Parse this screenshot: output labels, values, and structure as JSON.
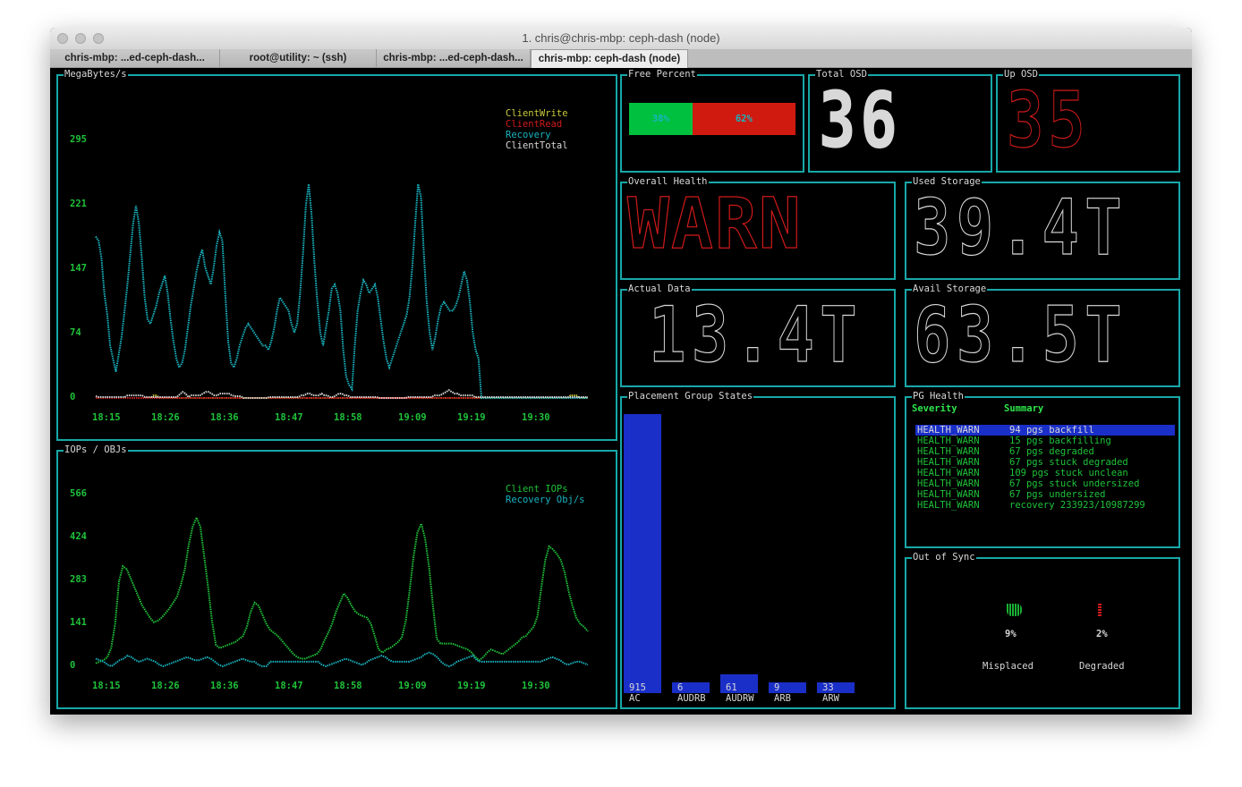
{
  "window": {
    "title": "1. chris@chris-mbp: ceph-dash (node)",
    "tabs": [
      {
        "label": "chris-mbp: ...ed-ceph-dash...",
        "active": false
      },
      {
        "label": "root@utility: ~ (ssh)",
        "active": false
      },
      {
        "label": "chris-mbp: ...ed-ceph-dash...",
        "active": false
      },
      {
        "label": "chris-mbp: ceph-dash (node)",
        "active": true
      }
    ]
  },
  "colors": {
    "border": "#18a8a8",
    "axis_green": "#1fc23a",
    "client_write": "#c8c83a",
    "client_read": "#d01a1a",
    "recovery": "#18b4c0",
    "client_total": "#d8d8d8",
    "client_iops": "#1fc23a",
    "bar_blue": "#1a2fc8",
    "free_green": "#00c040",
    "free_red": "#d01a10"
  },
  "mbps_panel": {
    "label": "MegaBytes/s",
    "legend": [
      "ClientWrite",
      "ClientRead",
      "Recovery",
      "ClientTotal"
    ]
  },
  "iops_panel": {
    "label": "IOPs / OBJs",
    "legend": [
      "Client IOPs",
      "Recovery Obj/s"
    ]
  },
  "chart_data": [
    {
      "type": "line",
      "title": "MegaBytes/s",
      "x": [
        "18:15",
        "18:26",
        "18:36",
        "18:47",
        "18:58",
        "19:09",
        "19:19",
        "19:30"
      ],
      "yticks": [
        "295",
        "221",
        "147",
        "74",
        "0"
      ],
      "ylim": [
        0,
        295
      ],
      "legend_position": "top-right",
      "series": [
        {
          "name": "ClientWrite",
          "values": [
            0,
            0,
            0,
            0,
            0,
            0,
            0,
            0,
            0,
            0,
            0,
            0,
            0,
            0,
            0,
            0,
            0,
            0,
            0,
            0,
            3,
            3,
            0,
            0,
            0,
            0,
            0,
            0,
            0,
            0,
            0,
            0,
            0,
            0,
            0,
            0,
            0,
            0,
            0,
            0,
            0,
            0,
            0,
            0,
            0,
            0,
            0,
            0,
            0,
            0,
            0,
            0,
            0,
            0,
            0,
            0,
            0,
            0,
            0,
            0,
            0,
            0,
            0,
            0,
            0,
            0,
            0,
            0,
            0,
            0,
            0,
            0,
            0,
            0,
            0,
            0,
            0,
            0,
            0,
            0,
            0,
            0,
            0,
            0,
            0,
            0,
            0,
            0,
            0,
            0,
            0,
            0,
            0,
            0,
            0,
            0,
            0,
            0,
            0,
            0,
            0,
            0,
            0,
            0,
            0,
            0,
            0,
            0,
            0,
            0,
            0,
            0,
            0,
            0,
            0,
            0,
            0,
            0,
            0,
            0,
            0,
            0,
            0,
            0,
            0,
            0,
            0,
            0,
            0,
            0,
            0,
            0,
            0,
            0,
            0,
            0,
            0,
            0,
            0,
            0,
            0,
            0,
            0,
            0,
            0,
            0,
            0,
            0,
            0,
            0,
            0,
            0,
            0,
            0,
            0,
            0,
            0,
            0,
            0,
            0,
            0,
            0,
            0,
            0,
            3,
            3,
            3,
            0,
            0,
            0,
            0
          ]
        },
        {
          "name": "ClientRead",
          "values": [
            0,
            0,
            0,
            0,
            0,
            0,
            0,
            0,
            0,
            0,
            0,
            0,
            0,
            0,
            0,
            0,
            0,
            0,
            0,
            0,
            0,
            0,
            0,
            0,
            0,
            0,
            0,
            0,
            0,
            0,
            0,
            0,
            0,
            0,
            0,
            0,
            0,
            0,
            0,
            0,
            0,
            0,
            0,
            0,
            0,
            0,
            0,
            0,
            0,
            0,
            0,
            0,
            0,
            0,
            0,
            0,
            0,
            0,
            0,
            0,
            0,
            0,
            0,
            0,
            0,
            0,
            0,
            0,
            0,
            0,
            0,
            0,
            0,
            0,
            0,
            0,
            0,
            0,
            0,
            0,
            0,
            0,
            0,
            0,
            0,
            0,
            0,
            0,
            0,
            0,
            0,
            0,
            0,
            0,
            0,
            0,
            0,
            0,
            0,
            0,
            0,
            0,
            0,
            0,
            0,
            0,
            0,
            0,
            0,
            0,
            0,
            0,
            0,
            0,
            0,
            0,
            0,
            0,
            0,
            0,
            0,
            0,
            0,
            0,
            0,
            0,
            0,
            0,
            0,
            0,
            0,
            0,
            0,
            0,
            0,
            0,
            0,
            0,
            0,
            0,
            0,
            0,
            0,
            0,
            0,
            0,
            0,
            0,
            0,
            0,
            0,
            0,
            0,
            0,
            0,
            0,
            0,
            0,
            0,
            0,
            0,
            0,
            0,
            0,
            0,
            0,
            0,
            0,
            0,
            0,
            0
          ]
        },
        {
          "name": "Recovery",
          "values": [
            185,
            180,
            160,
            120,
            95,
            60,
            45,
            30,
            50,
            70,
            100,
            130,
            165,
            200,
            220,
            200,
            160,
            115,
            90,
            85,
            95,
            105,
            120,
            130,
            140,
            120,
            90,
            65,
            45,
            35,
            40,
            55,
            80,
            105,
            125,
            145,
            160,
            170,
            150,
            140,
            130,
            150,
            175,
            190,
            180,
            120,
            65,
            40,
            35,
            45,
            60,
            70,
            80,
            85,
            80,
            75,
            70,
            65,
            60,
            60,
            55,
            65,
            80,
            100,
            115,
            110,
            105,
            100,
            85,
            75,
            85,
            120,
            165,
            220,
            245,
            210,
            155,
            110,
            75,
            60,
            80,
            100,
            125,
            130,
            120,
            100,
            55,
            25,
            15,
            10,
            60,
            100,
            120,
            135,
            130,
            120,
            125,
            130,
            115,
            90,
            65,
            45,
            35,
            45,
            55,
            65,
            75,
            85,
            95,
            115,
            150,
            200,
            245,
            230,
            165,
            110,
            75,
            55,
            70,
            90,
            105,
            110,
            105,
            100,
            100,
            105,
            115,
            130,
            145,
            135,
            110,
            75,
            55,
            45,
            0,
            0,
            0,
            0,
            0,
            0,
            0,
            0,
            0,
            0,
            0,
            0,
            0,
            0,
            0,
            0,
            0,
            0,
            0,
            0,
            0,
            0,
            0,
            0,
            0,
            0,
            0,
            0,
            0,
            0,
            0,
            0,
            0,
            0,
            0,
            0,
            0,
            0
          ]
        },
        {
          "name": "ClientTotal",
          "values": [
            2,
            1,
            1,
            1,
            1,
            1,
            1,
            1,
            1,
            1,
            1,
            3,
            3,
            3,
            3,
            3,
            3,
            1,
            1,
            1,
            1,
            1,
            1,
            1,
            1,
            1,
            1,
            1,
            1,
            4,
            7,
            5,
            1,
            3,
            3,
            3,
            3,
            5,
            7,
            7,
            5,
            3,
            3,
            5,
            5,
            5,
            5,
            3,
            2,
            2,
            2,
            0,
            0,
            0,
            0,
            0,
            0,
            0,
            0,
            0,
            1,
            1,
            1,
            1,
            1,
            1,
            1,
            1,
            1,
            1,
            1,
            3,
            3,
            5,
            5,
            3,
            3,
            3,
            5,
            3,
            3,
            1,
            1,
            3,
            5,
            5,
            3,
            3,
            1,
            1,
            1,
            1,
            1,
            1,
            1,
            1,
            1,
            1,
            0,
            0,
            0,
            0,
            0,
            0,
            0,
            0,
            0,
            0,
            1,
            1,
            1,
            1,
            1,
            1,
            1,
            1,
            1,
            3,
            3,
            3,
            5,
            7,
            9,
            7,
            5,
            5,
            3,
            3,
            3,
            3,
            3,
            1,
            1,
            1,
            1,
            1,
            1,
            1,
            1,
            1,
            1,
            1,
            1,
            1,
            1,
            1,
            1,
            1,
            1,
            1,
            1,
            1,
            1,
            1,
            1,
            1,
            1,
            1,
            1,
            1,
            1,
            1,
            1,
            1,
            1,
            1,
            1,
            1,
            1,
            1,
            1
          ]
        }
      ]
    },
    {
      "type": "line",
      "title": "IOPs / OBJs",
      "x": [
        "18:15",
        "18:26",
        "18:36",
        "18:47",
        "18:58",
        "19:09",
        "19:19",
        "19:30"
      ],
      "yticks": [
        "566",
        "424",
        "283",
        "141",
        "0"
      ],
      "ylim": [
        0,
        566
      ],
      "legend_position": "top-right",
      "series": [
        {
          "name": "Client IOPs",
          "values": [
            10,
            15,
            20,
            30,
            60,
            140,
            280,
            330,
            320,
            290,
            260,
            230,
            200,
            180,
            160,
            145,
            150,
            160,
            175,
            190,
            210,
            230,
            270,
            320,
            400,
            460,
            490,
            460,
            360,
            260,
            150,
            70,
            60,
            65,
            70,
            75,
            80,
            90,
            100,
            130,
            180,
            210,
            200,
            170,
            140,
            120,
            110,
            100,
            85,
            70,
            55,
            40,
            30,
            25,
            25,
            30,
            35,
            40,
            55,
            85,
            110,
            140,
            180,
            210,
            240,
            225,
            200,
            180,
            170,
            165,
            160,
            140,
            100,
            55,
            45,
            55,
            60,
            70,
            80,
            95,
            150,
            250,
            360,
            440,
            470,
            420,
            330,
            200,
            90,
            75,
            75,
            75,
            75,
            70,
            65,
            60,
            55,
            45,
            30,
            20,
            30,
            45,
            55,
            50,
            45,
            40,
            50,
            60,
            70,
            80,
            95,
            100,
            115,
            130,
            165,
            260,
            350,
            395,
            385,
            370,
            350,
            310,
            250,
            200,
            160,
            140,
            130,
            115
          ]
        },
        {
          "name": "Recovery Obj/s",
          "values": [
            25,
            20,
            15,
            5,
            0,
            10,
            20,
            25,
            35,
            30,
            20,
            15,
            20,
            25,
            20,
            15,
            5,
            0,
            5,
            10,
            15,
            20,
            25,
            30,
            25,
            20,
            20,
            25,
            30,
            25,
            15,
            5,
            0,
            5,
            10,
            15,
            20,
            25,
            20,
            15,
            15,
            5,
            0,
            0,
            15,
            15,
            15,
            15,
            15,
            15,
            15,
            15,
            15,
            15,
            15,
            15,
            15,
            5,
            0,
            5,
            10,
            15,
            20,
            25,
            20,
            15,
            10,
            5,
            10,
            20,
            25,
            30,
            35,
            30,
            20,
            15,
            15,
            15,
            15,
            15,
            20,
            25,
            30,
            40,
            45,
            40,
            30,
            15,
            5,
            0,
            5,
            15,
            20,
            25,
            30,
            35,
            20,
            15,
            15,
            15,
            15,
            15,
            15,
            15,
            15,
            15,
            15,
            15,
            15,
            15,
            15,
            15,
            15,
            20,
            25,
            30,
            25,
            20,
            10,
            5,
            10,
            15,
            15,
            10,
            5
          ]
        }
      ]
    },
    {
      "type": "bar",
      "title": "Placement Group States",
      "categories": [
        "AC",
        "AUDRB",
        "AUDRW",
        "ARB",
        "ARW"
      ],
      "values": [
        915,
        6,
        61,
        9,
        33
      ],
      "ylim": [
        0,
        915
      ]
    }
  ],
  "free_percent": {
    "label": "Free Percent",
    "used_pct": 38,
    "free_pct": 62,
    "used_text": "38%",
    "free_text": "62%"
  },
  "total_osd": {
    "label": "Total OSD",
    "value": "36"
  },
  "up_osd": {
    "label": "Up OSD",
    "value": "35"
  },
  "overall_health": {
    "label": "Overall Health",
    "value": "WARN"
  },
  "used_storage": {
    "label": "Used Storage",
    "value": "39.4T"
  },
  "actual_data": {
    "label": "Actual Data",
    "value": "13.4T"
  },
  "avail_storage": {
    "label": "Avail Storage",
    "value": "63.5T"
  },
  "pg_states": {
    "label": "Placement Group States"
  },
  "pg_health": {
    "label": "PG Health",
    "headers": {
      "severity": "Severity",
      "summary": "Summary"
    },
    "rows": [
      {
        "severity": "HEALTH_WARN",
        "summary": "94 pgs backfill",
        "selected": true
      },
      {
        "severity": "HEALTH_WARN",
        "summary": "15 pgs backfilling"
      },
      {
        "severity": "HEALTH_WARN",
        "summary": "67 pgs degraded"
      },
      {
        "severity": "HEALTH_WARN",
        "summary": "67 pgs stuck degraded"
      },
      {
        "severity": "HEALTH_WARN",
        "summary": "109 pgs stuck unclean"
      },
      {
        "severity": "HEALTH_WARN",
        "summary": "67 pgs stuck undersized"
      },
      {
        "severity": "HEALTH_WARN",
        "summary": "67 pgs undersized"
      },
      {
        "severity": "HEALTH_WARN",
        "summary": "recovery 233923/10987299"
      }
    ]
  },
  "out_of_sync": {
    "label": "Out of Sync",
    "misplaced": {
      "pct": 9,
      "text": "9%",
      "label": "Misplaced"
    },
    "degraded": {
      "pct": 2,
      "text": "2%",
      "label": "Degraded"
    }
  }
}
